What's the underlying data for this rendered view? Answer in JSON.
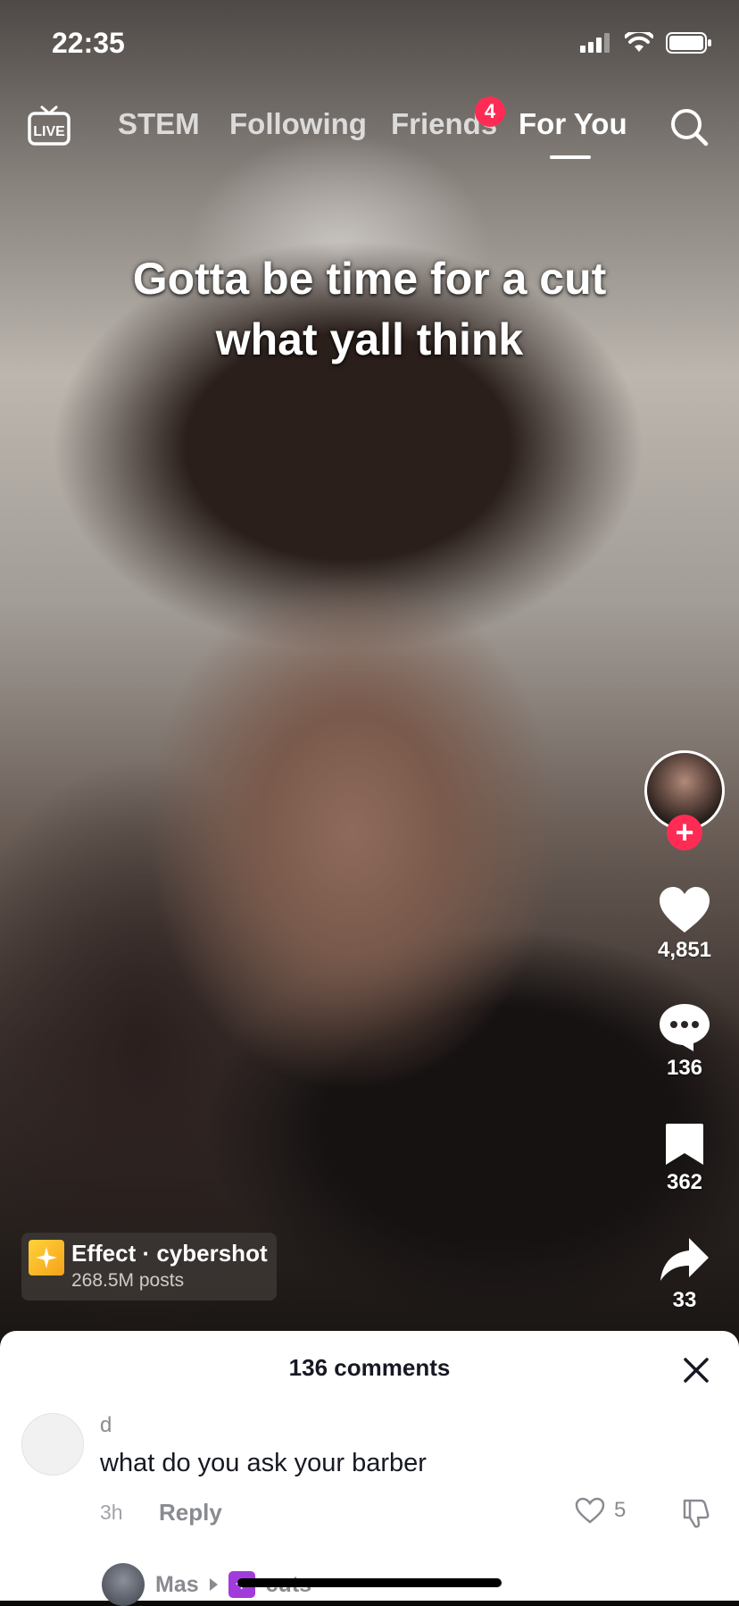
{
  "status_bar": {
    "time": "22:35"
  },
  "top_nav": {
    "live_label": "LIVE",
    "tabs": [
      {
        "label": "STEM"
      },
      {
        "label": "Following"
      },
      {
        "label": "Friends",
        "badge": "4"
      },
      {
        "label": "For You",
        "active": true
      }
    ]
  },
  "video": {
    "caption_line1": "Gotta be time for a cut",
    "caption_line2": "what yall think"
  },
  "actions": {
    "likes": "4,851",
    "comments": "136",
    "saves": "362",
    "shares": "33"
  },
  "effect": {
    "title": "Effect · cybershot",
    "posts": "268.5M posts"
  },
  "comments_sheet": {
    "title": "136 comments",
    "comment": {
      "user": "d",
      "text": "what do you ask your barber",
      "time": "3h",
      "reply_label": "Reply",
      "likes": "5"
    },
    "reply_preview": {
      "user": "Mas",
      "target": "cuts"
    }
  },
  "colors": {
    "accent": "#fe2c55",
    "sheet_bg": "#ffffff",
    "text_primary": "#161823",
    "text_secondary": "#8a8b91"
  },
  "icons": [
    "live-tv-icon",
    "search-icon",
    "plus-icon",
    "heart-icon",
    "comment-icon",
    "bookmark-icon",
    "share-icon",
    "effect-icon",
    "close-icon",
    "dislike-icon"
  ]
}
